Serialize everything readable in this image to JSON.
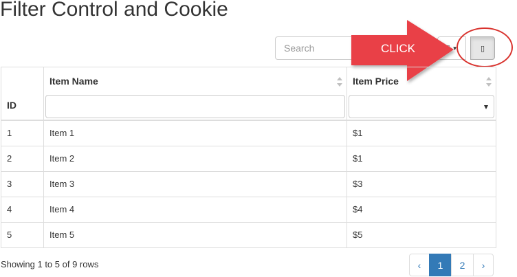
{
  "page": {
    "title": "Filter Control and Cookie"
  },
  "toolbar": {
    "search_placeholder": "Search",
    "columns_icon": "columns-icon",
    "clear_icon": "clear-filters-icon"
  },
  "annotation": {
    "callout_label": "CLICK",
    "arrow_color": "#e94046",
    "circle_color": "#d9332e"
  },
  "table": {
    "columns": [
      {
        "label": "ID"
      },
      {
        "label": "Item Name"
      },
      {
        "label": "Item Price"
      }
    ],
    "rows": [
      {
        "id": "1",
        "name": "Item 1",
        "price": "$1"
      },
      {
        "id": "2",
        "name": "Item 2",
        "price": "$1"
      },
      {
        "id": "3",
        "name": "Item 3",
        "price": "$3"
      },
      {
        "id": "4",
        "name": "Item 4",
        "price": "$4"
      },
      {
        "id": "5",
        "name": "Item 5",
        "price": "$5"
      }
    ]
  },
  "pagination": {
    "info": "Showing 1 to 5 of 9 rows",
    "prev": "‹",
    "pages": [
      "1",
      "2"
    ],
    "active_page": "1",
    "next": "›",
    "accent": "#337ab7"
  }
}
